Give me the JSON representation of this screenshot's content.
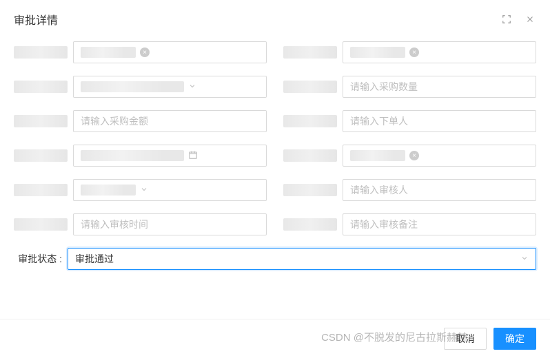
{
  "header": {
    "title": "审批详情"
  },
  "form": {
    "row1": {
      "left_clear": "×",
      "right_clear": "×"
    },
    "row2": {
      "right_placeholder": "请输入采购数量"
    },
    "row3": {
      "left_placeholder": "请输入采购金额",
      "right_placeholder": "请输入下单人"
    },
    "row4": {
      "right_clear": "×"
    },
    "row5": {
      "right_placeholder": "请输入审核人"
    },
    "row6": {
      "left_placeholder": "请输入审核时间",
      "right_placeholder": "请输入审核备注"
    },
    "approval": {
      "label": "审批状态 :",
      "value": "审批通过"
    }
  },
  "footer": {
    "cancel": "取消",
    "confirm": "确定"
  },
  "watermark": "CSDN @不脱发的尼古拉斯赫赫"
}
